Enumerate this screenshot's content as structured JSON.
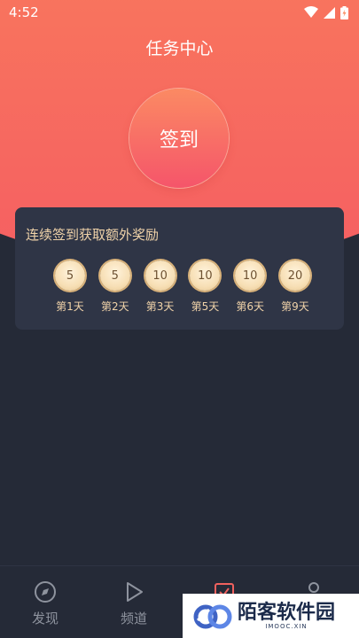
{
  "status_bar": {
    "time": "4:52",
    "icons": [
      "wifi-icon",
      "signal-icon",
      "battery-icon"
    ]
  },
  "header": {
    "title": "任务中心"
  },
  "signin": {
    "label": "签到"
  },
  "bonus": {
    "title": "连续签到获取额外奖励",
    "rewards": [
      {
        "value": "5",
        "day": "第1天"
      },
      {
        "value": "5",
        "day": "第2天"
      },
      {
        "value": "10",
        "day": "第3天"
      },
      {
        "value": "10",
        "day": "第5天"
      },
      {
        "value": "10",
        "day": "第6天"
      },
      {
        "value": "20",
        "day": "第9天"
      }
    ]
  },
  "tabbar": {
    "items": [
      {
        "label": "发现",
        "icon": "compass-icon"
      },
      {
        "label": "频道",
        "icon": "play-icon"
      },
      {
        "label": "",
        "icon": "task-check-icon",
        "active": true
      },
      {
        "label": "",
        "icon": "user-icon"
      }
    ]
  },
  "watermark": {
    "text": "陌客软件园",
    "sub": "IMOOC.XIN"
  },
  "colors": {
    "accent": "#f0615e",
    "gold": "#f0d3a9",
    "background": "#252a37",
    "card": "#2f3546"
  }
}
